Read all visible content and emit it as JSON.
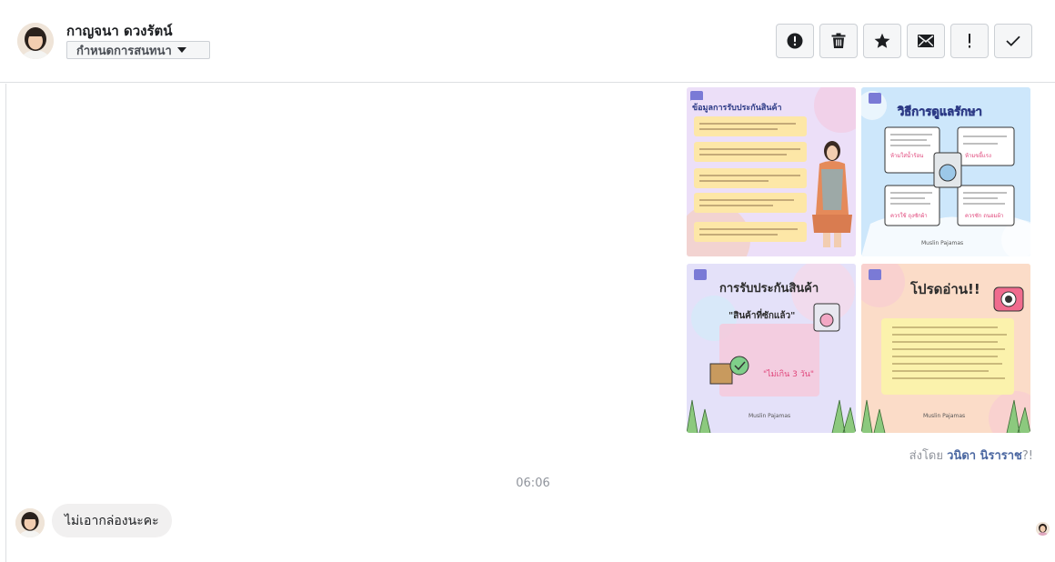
{
  "header": {
    "contact_name": "กาญจนา ดวงรัตน์",
    "assign_label": "กำหนดการสนทนา",
    "toolbar": [
      {
        "name": "report-spam-button",
        "icon": "alert-circle-icon"
      },
      {
        "name": "delete-button",
        "icon": "trash-icon"
      },
      {
        "name": "star-button",
        "icon": "star-icon"
      },
      {
        "name": "mark-unread-button",
        "icon": "envelope-icon"
      },
      {
        "name": "follow-up-button",
        "icon": "exclamation-icon"
      },
      {
        "name": "mark-done-button",
        "icon": "check-icon"
      }
    ]
  },
  "conversation": {
    "images": [
      {
        "title": "ข้อมูลการรับประกันสินค้า",
        "theme": "#e8d8f5"
      },
      {
        "title": "วิธีการดูแลรักษา",
        "sub1": "ห้ามใส่น้ำร้อน",
        "sub2": "ห้ามขยี้แรง",
        "sub3": "ควรใช้ ถุงซักผ้า",
        "sub4": "ควรซัก ถนอมผ้า",
        "brand": "Muslin Pajamas",
        "theme": "#cfe8fb"
      },
      {
        "title": "การรับประกันสินค้า",
        "sub1": "\"สินค้าที่ซักแล้ว\"",
        "sub2": "\"ไม่เกิน 3 วัน\"",
        "brand": "Muslin Pajamas",
        "theme": "#e9e3fb"
      },
      {
        "title": "โปรดอ่าน!!",
        "brand": "Muslin Pajamas",
        "theme": "#fde0c6"
      }
    ],
    "sent_by_prefix": "ส่งโดย",
    "sent_by_name": "วนิดา นิราราช",
    "sent_by_suffix": "?!",
    "timestamp": "06:06",
    "incoming_message": "ไม่เอากล่องนะคะ"
  }
}
